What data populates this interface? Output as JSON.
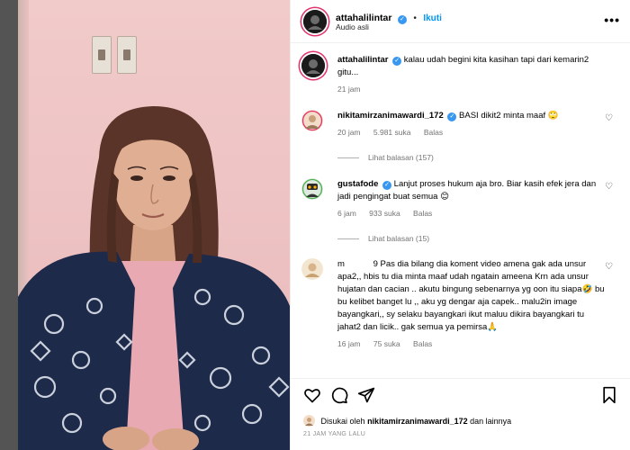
{
  "header": {
    "username": "attahalilintar",
    "follow_label": "Ikuti",
    "subtitle": "Audio asli",
    "more": "•••"
  },
  "caption": {
    "username": "attahalilintar",
    "text": "kalau udah begini kita kasihan tapi dari kemarin2 gitu...",
    "time": "21 jam"
  },
  "comments": [
    {
      "username": "nikitamirzanimawardi_172",
      "text": "BASI dikit2 minta maaf 🙄",
      "time": "20 jam",
      "likes": "5.981 suka",
      "reply": "Balas",
      "view_replies": "Lihat balasan (157)"
    },
    {
      "username": "gustafode",
      "text": "Lanjut proses hukum aja bro. Biar kasih efek jera dan jadi pengingat buat semua 😊",
      "time": "6 jam",
      "likes": "933 suka",
      "reply": "Balas",
      "view_replies": "Lihat balasan (15)"
    },
    {
      "username": "m            9",
      "text": "Pas dia bilang dia koment video amena gak ada unsur apa2,, hbis tu dia minta maaf udah ngatain ameena Krn ada unsur hujatan dan cacian .. akutu bingung sebenarnya yg oon itu siapa🤣 bu bu kelibet banget lu ,, aku yg dengar aja capek.. malu2in image bayangkari,, sy selaku bayangkari ikut maluu dikira bayangkari tu jahat2 dan licik.. gak semua ya pemirsa🙏",
      "time": "16 jam",
      "likes": "75 suka",
      "reply": "Balas"
    }
  ],
  "footer": {
    "liked_prefix": "Disukai oleh",
    "liked_user": "nikitamirzanimawardi_172",
    "liked_suffix": "dan lainnya",
    "time_ago": "21 JAM YANG LALU"
  },
  "colors": {
    "accent": "#0095f6",
    "verified": "#3897f0",
    "wall": "#eec3c3"
  }
}
